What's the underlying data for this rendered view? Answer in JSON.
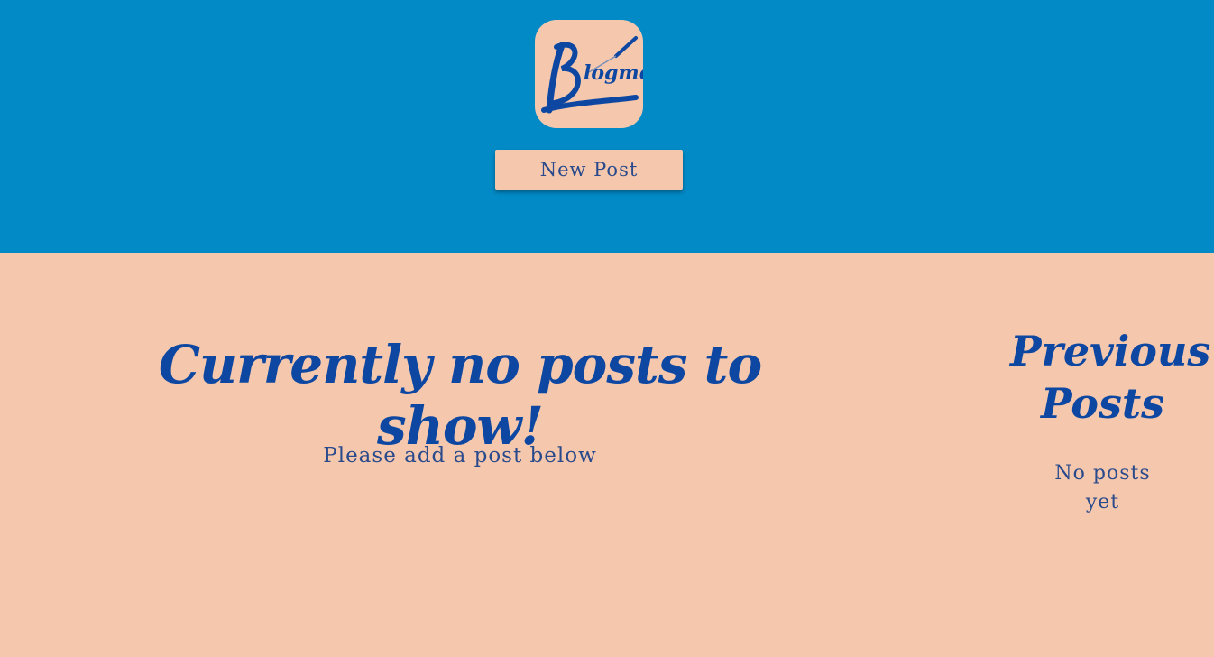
{
  "header": {
    "logo_text": "Blogme",
    "new_post_label": "New Post"
  },
  "main": {
    "headline": "Currently no posts to show!",
    "subtext": "Please add a post below"
  },
  "sidebar": {
    "title": "Previous Posts",
    "empty_text": "No posts yet"
  },
  "colors": {
    "header_bg": "#028ac6",
    "page_bg": "#f5c8ad",
    "accent_text": "#0d47a1",
    "body_text": "#2a4a8c"
  }
}
